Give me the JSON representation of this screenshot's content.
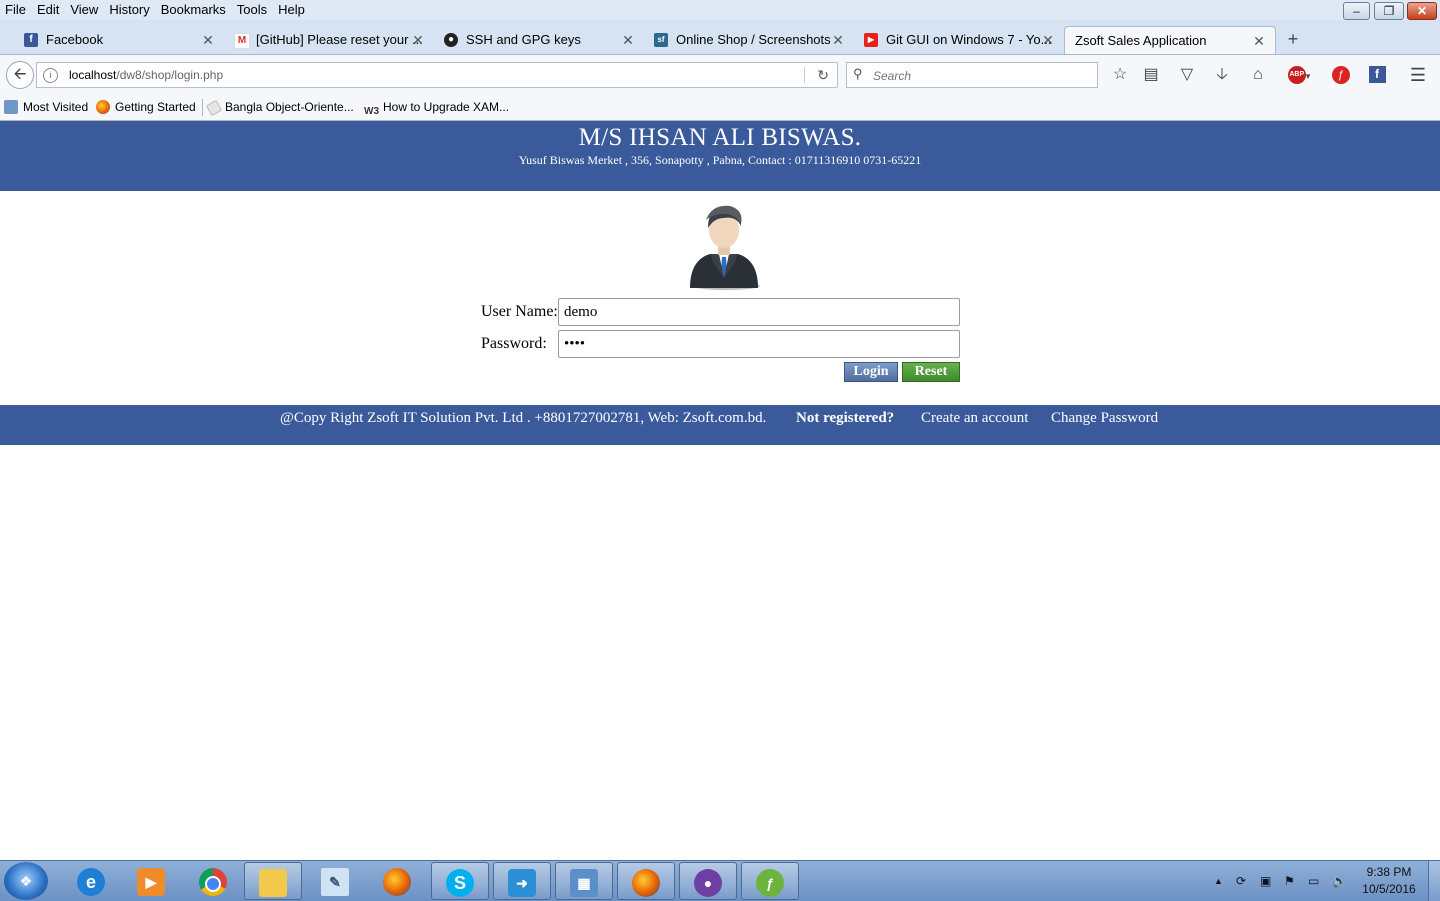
{
  "menu": [
    "File",
    "Edit",
    "View",
    "History",
    "Bookmarks",
    "Tools",
    "Help"
  ],
  "tabs": [
    {
      "label": "Facebook",
      "icon": "facebook-icon",
      "color": "#3b5998",
      "glyph": "f"
    },
    {
      "label": "[GitHub] Please reset your ...",
      "icon": "gmail-icon",
      "color": "#d93025",
      "glyph": "M"
    },
    {
      "label": "SSH and GPG keys",
      "icon": "github-icon",
      "color": "#222222",
      "glyph": "●"
    },
    {
      "label": "Online Shop / Screenshots",
      "icon": "sourceforge-icon",
      "color": "#2a6a8a",
      "glyph": "sf"
    },
    {
      "label": "Git GUI on Windows 7 - Yo...",
      "icon": "youtube-icon",
      "color": "#e62117",
      "glyph": "▶"
    },
    {
      "label": "Zsoft Sales Application",
      "icon": "",
      "color": "",
      "glyph": ""
    }
  ],
  "address": {
    "host": "localhost",
    "path": "/dw8/shop/login.php"
  },
  "search": {
    "placeholder": "Search"
  },
  "bookmarks": [
    {
      "label": "Most Visited",
      "icon": "most-visited-icon"
    },
    {
      "label": "Getting Started",
      "icon": "firefox-icon"
    },
    {
      "label": "Bangla Object-Oriente...",
      "icon": "tag-icon"
    },
    {
      "label": "How to Upgrade XAM...",
      "icon": "w3-icon"
    }
  ],
  "banner": {
    "title": "M/S IHSAN ALI BISWAS.",
    "subtitle": "Yusuf Biswas Merket , 356, Sonapotty , Pabna, Contact : 01711316910 0731-65221"
  },
  "login": {
    "username_label": "User Name:",
    "username_value": "demo",
    "password_label": "Password:",
    "password_value": "demo",
    "login_button": "Login",
    "reset_button": "Reset"
  },
  "footer": {
    "copyright": "@Copy Right Zsoft IT Solution Pvt. Ltd . +8801727002781, Web: Zsoft.com.bd.",
    "not_registered": "Not registered?",
    "create_account": "Create an account",
    "change_password": "Change Password"
  },
  "clock": {
    "time": "9:38 PM",
    "date": "10/5/2016"
  },
  "colors": {
    "banner": "#3a5a9c",
    "login_button": "#5a78a8",
    "reset_button": "#4a9a34"
  }
}
